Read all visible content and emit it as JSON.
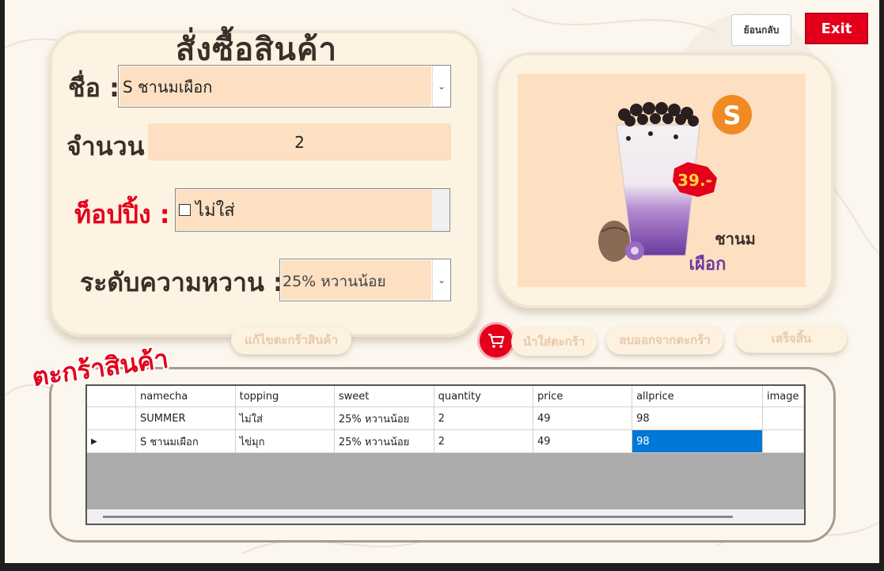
{
  "window": {
    "title": "สั่งซื้อสินค้า",
    "back_label": "ย้อนกลับ",
    "exit_label": "Exit"
  },
  "form": {
    "name_label": "ชื่อ :",
    "name_value": "S  ชานมเผือก",
    "qty_label": "จำนวน",
    "qty_value": "2",
    "topping_label": "ท็อปปิ้ง :",
    "topping_value": "ไม่ใส่",
    "sweet_label": "ระดับความหวาน :",
    "sweet_value": "25%  หวานน้อย"
  },
  "product_image": {
    "size_badge": "S",
    "price_tag": "39.-",
    "name_line1": "ชานม",
    "name_line2": "เผือก"
  },
  "actions": {
    "edit_cart": "แก้ไขตะกร้าสินค้า",
    "add_to_cart": "นำใส่ตะกร้า",
    "remove_from_cart": "ลบออกจากตะกร้า",
    "finish": "เสร็จสิ้น"
  },
  "cart": {
    "title": "ตะกร้าสินค้า",
    "columns": [
      "namecha",
      "topping",
      "sweet",
      "quantity",
      "price",
      "allprice",
      "image"
    ],
    "rows": [
      [
        "SUMMER",
        "ไม่ใส่",
        "25% หวานน้อย",
        "2",
        "49",
        "98",
        ""
      ],
      [
        "S ชานมเผือก",
        "ไข่มุก",
        "25% หวานน้อย",
        "2",
        "49",
        "98",
        ""
      ]
    ]
  },
  "colors": {
    "accent_red": "#e4001b",
    "field_bg": "#fde0c2",
    "panel_bg": "#fdf3e2",
    "selected_cell": "#0078d7"
  }
}
